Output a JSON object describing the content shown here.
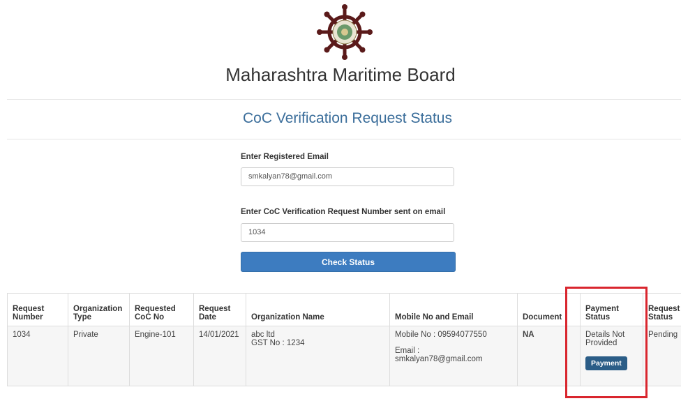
{
  "header": {
    "logo_icon": "ships-wheel-emblem-icon",
    "org_name": "Maharashtra Maritime Board",
    "page_title": "CoC Verification Request Status"
  },
  "form": {
    "email_label": "Enter Registered Email",
    "email_value": "smkalyan78@gmail.com",
    "request_label": "Enter CoC Verification Request Number sent on email",
    "request_value": "1034",
    "check_button": "Check Status"
  },
  "table": {
    "headers": {
      "request_number": [
        "Request",
        "Number"
      ],
      "organization_type": [
        "Organization",
        "Type"
      ],
      "requested_coc_no": [
        "Requested",
        "CoC No"
      ],
      "request_date": [
        "Request",
        "Date"
      ],
      "organization_name": "Organization Name",
      "mobile_email": "Mobile No and Email",
      "document": "Document",
      "payment_status": [
        "Payment",
        "Status"
      ],
      "request_status": [
        "Request",
        "Status"
      ]
    },
    "rows": [
      {
        "request_number": "1034",
        "organization_type": "Private",
        "requested_coc_no": "Engine-101",
        "request_date": "14/01/2021",
        "organization_name": "abc ltd",
        "gst": "GST No : 1234",
        "mobile": "Mobile No : 09594077550",
        "email_label": "Email :",
        "email": "smkalyan78@gmail.com",
        "document": "NA",
        "payment_status": [
          "Details Not",
          "Provided"
        ],
        "payment_button": "Payment",
        "request_status": "Pending"
      }
    ]
  },
  "colors": {
    "accent": "#3a6d9a",
    "button": "#3d7cc0",
    "payment_button": "#2b5d87",
    "highlight": "#d9262e"
  }
}
